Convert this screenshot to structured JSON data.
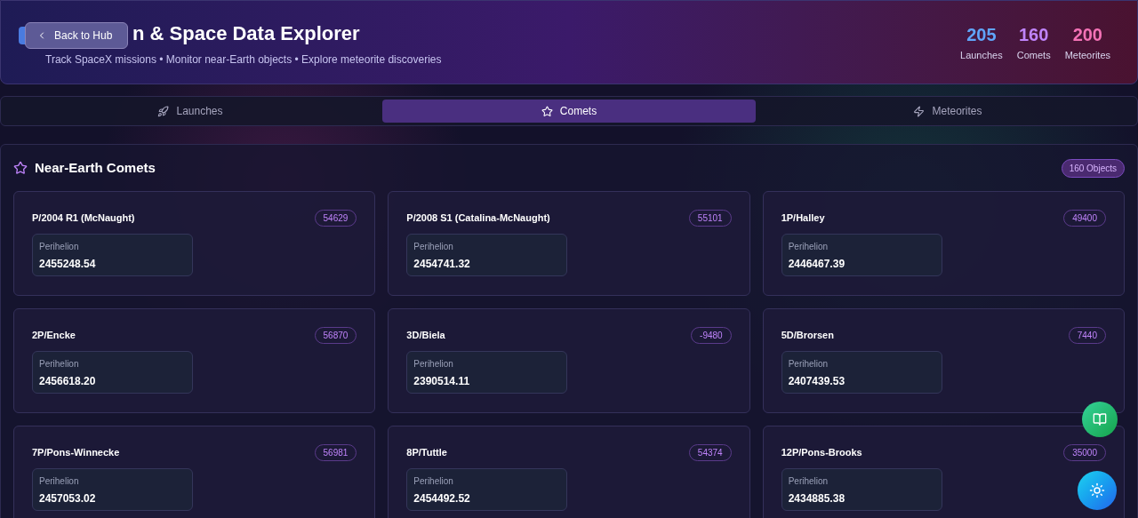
{
  "header": {
    "title": "n & Space Data Explorer",
    "subtitle": "Track SpaceX missions • Monitor near-Earth objects • Explore meteorite discoveries",
    "back_button": "Back to Hub",
    "stats": [
      {
        "value": "205",
        "label": "Launches",
        "color": "#60a5fa"
      },
      {
        "value": "160",
        "label": "Comets",
        "color": "#c084fc"
      },
      {
        "value": "200",
        "label": "Meteorites",
        "color": "#f472b6"
      }
    ]
  },
  "tabs": [
    {
      "label": "Launches",
      "kind": "rocket",
      "selected": false
    },
    {
      "label": "Comets",
      "kind": "star",
      "selected": true
    },
    {
      "label": "Meteorites",
      "kind": "zap",
      "selected": false
    }
  ],
  "section": {
    "title": "Near-Earth Comets",
    "count": "160 Objects"
  },
  "comets": [
    {
      "name": "P/2004 R1 (McNaught)",
      "badge": "54629",
      "field_label": "Perihelion",
      "value": "2455248.54"
    },
    {
      "name": "P/2008 S1 (Catalina-McNaught)",
      "badge": "55101",
      "field_label": "Perihelion",
      "value": "2454741.32"
    },
    {
      "name": "1P/Halley",
      "badge": "49400",
      "field_label": "Perihelion",
      "value": "2446467.39"
    },
    {
      "name": "2P/Encke",
      "badge": "56870",
      "field_label": "Perihelion",
      "value": "2456618.20"
    },
    {
      "name": "3D/Biela",
      "badge": "-9480",
      "field_label": "Perihelion",
      "value": "2390514.11"
    },
    {
      "name": "5D/Brorsen",
      "badge": "7440",
      "field_label": "Perihelion",
      "value": "2407439.53"
    },
    {
      "name": "7P/Pons-Winnecke",
      "badge": "56981",
      "field_label": "Perihelion",
      "value": "2457053.02"
    },
    {
      "name": "8P/Tuttle",
      "badge": "54374",
      "field_label": "Perihelion",
      "value": "2454492.52"
    },
    {
      "name": "12P/Pons-Brooks",
      "badge": "35000",
      "field_label": "Perihelion",
      "value": "2434885.38"
    }
  ]
}
